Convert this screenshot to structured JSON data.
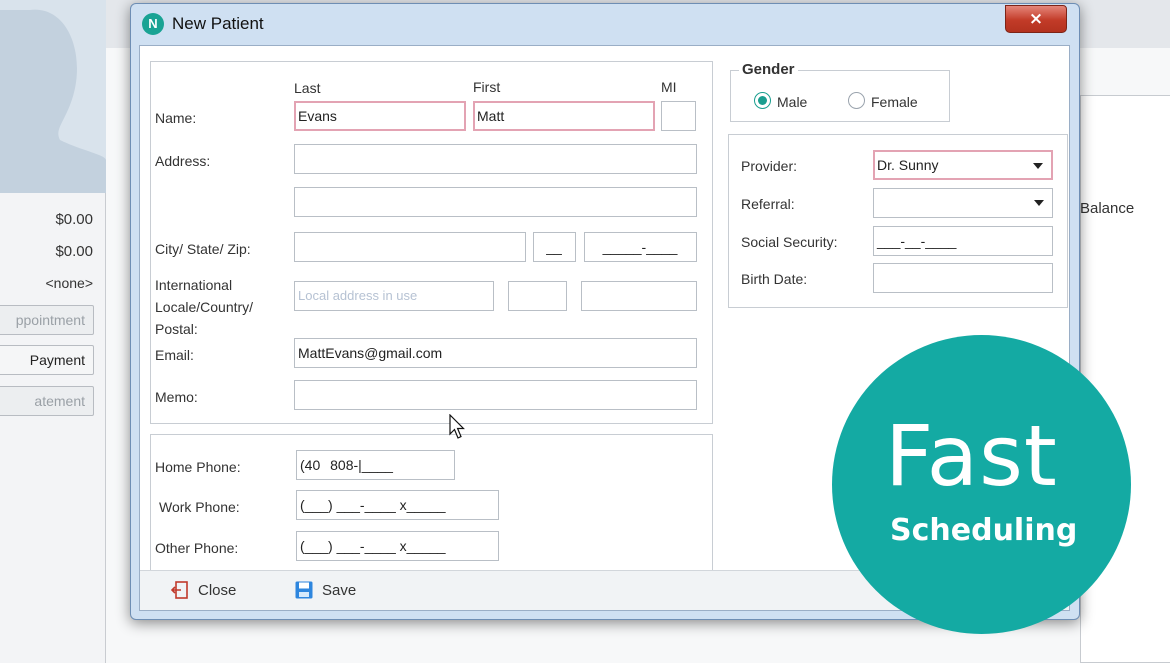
{
  "background": {
    "amounts": [
      "$0.00",
      "$0.00",
      "<none>"
    ],
    "buttons": [
      "ppointment",
      "Payment",
      "atement"
    ],
    "balance_label": "Balance"
  },
  "dialog": {
    "title": "New Patient",
    "icon_letter": "N",
    "close_glyph": "×",
    "name": {
      "label": "Name:",
      "col_last": "Last",
      "col_first": "First",
      "col_mi": "MI",
      "last_value": "Evans",
      "first_value": "Matt",
      "mi_value": ""
    },
    "address": {
      "label": "Address:",
      "line1": "",
      "line2": ""
    },
    "city": {
      "label": "City/ State/ Zip:",
      "city_value": "",
      "state_value": "__",
      "zip_value": "_____-____"
    },
    "international": {
      "label_lines": [
        "International",
        "Locale/Country/",
        "Postal:"
      ],
      "locale_placeholder": "Local address in use",
      "country_value": "",
      "postal_value": ""
    },
    "email": {
      "label": "Email:",
      "value": "MattEvans@gmail.com"
    },
    "memo": {
      "label": "Memo:",
      "value": ""
    },
    "phones": {
      "home_label": "Home Phone:",
      "home_value": "(40",
      "home_rest": "808-|____",
      "work_label": "Work Phone:",
      "work_value": "(___) ___-____ x_____",
      "other_label": "Other Phone:",
      "other_value": "(___) ___-____ x_____"
    },
    "gender": {
      "legend": "Gender",
      "male": "Male",
      "female": "Female",
      "selected": "Male"
    },
    "provider": {
      "label": "Provider:",
      "value": "Dr. Sunny"
    },
    "referral": {
      "label": "Referral:",
      "value": ""
    },
    "ssn": {
      "label": "Social Security:",
      "value": "___-__-____"
    },
    "birth": {
      "label": "Birth Date:",
      "value": ""
    },
    "footer": {
      "close_label": "Close",
      "save_label": "Save"
    }
  },
  "overlay": {
    "line1": "Fast",
    "line2": "Scheduling"
  },
  "colors": {
    "accent": "#14aaa3",
    "required_border": "#e3a3b3",
    "close_red": "#c23b28"
  }
}
